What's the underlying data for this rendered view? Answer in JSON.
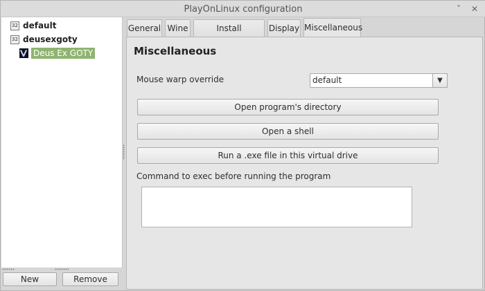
{
  "window": {
    "title": "PlayOnLinux configuration",
    "minimize_icon": "˅",
    "close_icon": "✕"
  },
  "tree": {
    "items": [
      {
        "label": "default",
        "badge": "32"
      },
      {
        "label": "deusexgoty",
        "badge": "32"
      },
      {
        "label": "Deus Ex GOTY"
      }
    ]
  },
  "left_buttons": {
    "new_label": "New",
    "remove_label": "Remove"
  },
  "tabs": [
    {
      "label": "General"
    },
    {
      "label": "Wine"
    },
    {
      "label": "Install components"
    },
    {
      "label": "Display"
    },
    {
      "label": "Miscellaneous"
    }
  ],
  "misc": {
    "title": "Miscellaneous",
    "mouse_warp_label": "Mouse warp override",
    "mouse_warp_value": "default",
    "dropdown_icon": "▼",
    "open_dir_label": "Open program's directory",
    "open_shell_label": "Open a shell",
    "run_exe_label": "Run a .exe file in this virtual drive",
    "command_label": "Command to exec before running the program",
    "command_value": ""
  }
}
